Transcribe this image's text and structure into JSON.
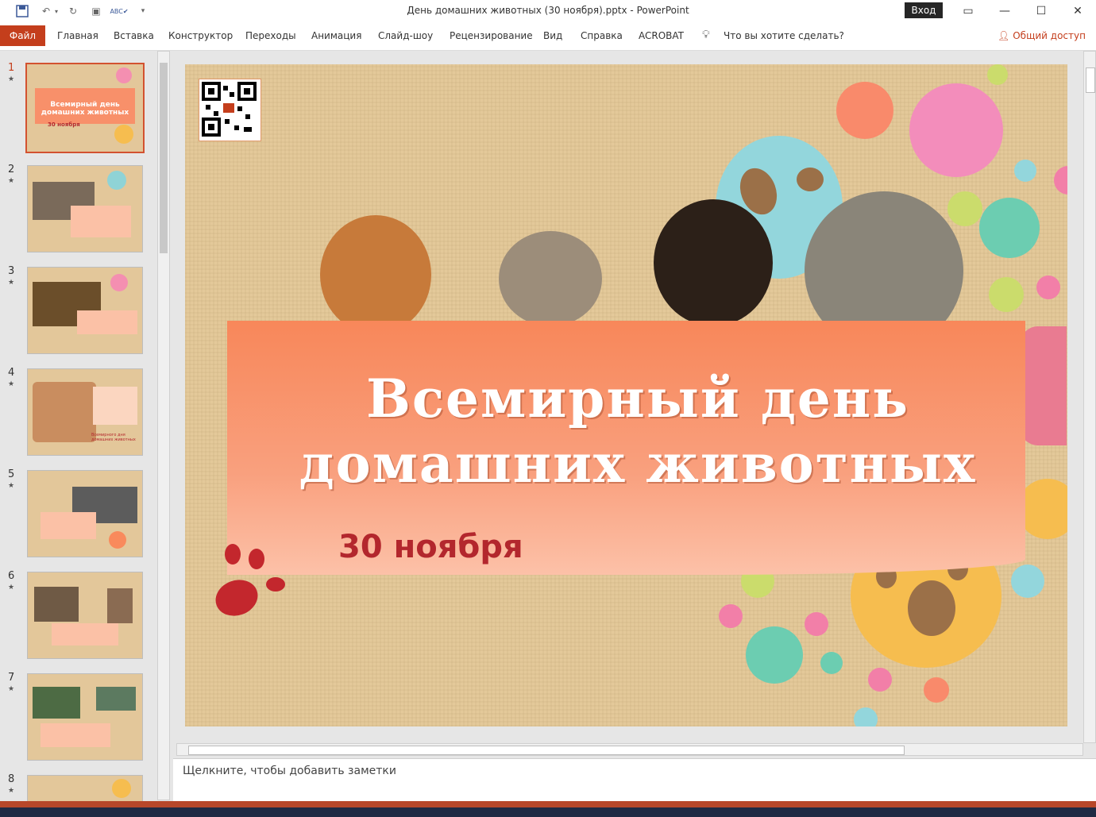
{
  "window": {
    "title": "День домашних животных (30 ноября).pptx  -  PowerPoint",
    "signin_label": "Вход"
  },
  "ribbon": {
    "file_label": "Файл",
    "tabs": [
      "Главная",
      "Вставка",
      "Конструктор",
      "Переходы",
      "Анимация",
      "Слайд-шоу",
      "Рецензирование",
      "Вид",
      "Справка",
      "ACROBAT"
    ],
    "tell_me": "Что вы хотите сделать?",
    "share_label": "Общий доступ"
  },
  "thumbnails": [
    {
      "num": "1",
      "title": "Всемирный день домашних животных",
      "date": "30 ноября"
    },
    {
      "num": "2"
    },
    {
      "num": "3"
    },
    {
      "num": "4",
      "caption": "Всемирного дня домашних животных"
    },
    {
      "num": "5"
    },
    {
      "num": "6"
    },
    {
      "num": "7"
    },
    {
      "num": "8"
    }
  ],
  "slide": {
    "title_line1": "Всемирный день",
    "title_line2": "домашних животных",
    "date": "30 ноября"
  },
  "notes": {
    "placeholder": "Щелкните, чтобы добавить заметки"
  },
  "colors": {
    "accent": "#c43e1c",
    "banner": "#f8875a",
    "date_text": "#b3272d"
  }
}
